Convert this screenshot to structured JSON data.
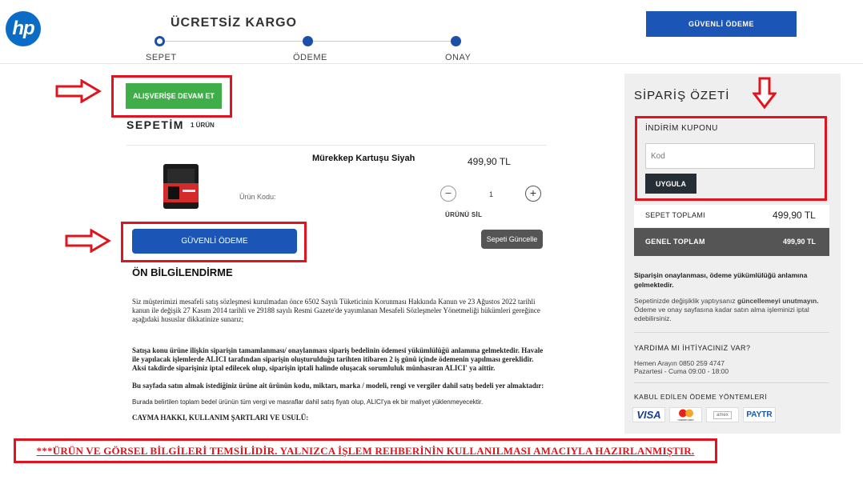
{
  "header": {
    "logo_text": "hp",
    "free_shipping": "ÜCRETSİZ KARGO",
    "steps": [
      "SEPET",
      "ÖDEME",
      "ONAY"
    ],
    "secure_button": "GÜVENLİ ÖDEME"
  },
  "cart": {
    "continue_button": "ALIŞVERİŞE DEVAM ET",
    "title": "SEPETİM",
    "count": "1 ÜRÜN",
    "item": {
      "name": "Mürekkep Kartuşu Siyah",
      "price": "499,90 TL",
      "code_label": "Ürün Kodu:",
      "quantity": "1",
      "remove": "ÜRÜNÜ SİL"
    },
    "secure_button": "GÜVENLİ ÖDEME",
    "update_button": "Sepeti Güncelle"
  },
  "info": {
    "title": "ÖN BİLGİLENDİRME",
    "p1": "Siz müşterimizi mesafeli satış sözleşmesi kurulmadan önce 6502 Sayılı Tüketicinin Korunması Hakkında Kanun ve 23 Ağustos 2022 tarihli kanun ile değişik 27 Kasım 2014 tarihli ve 29188 sayılı Resmi Gazete'de yayımlanan Mesafeli Sözleşmeler Yönetmeliği hükümleri gereğince aşağıdaki hususlar dikkatinize sunarız;",
    "p2": "Satışa konu ürüne ilişkin siparişin tamamlanması/ onaylanması sipariş bedelinin ödemesi yükümlülüğü anlamına gelmektedir. Havale ile yapılacak işlemlerde ALICI tarafından siparişin oluşturulduğu tarihten itibaren 2 iş günü içinde ödemenin yapılması gereklidir. Aksi takdirde siparişiniz iptal edilecek olup, siparişin iptali halinde oluşacak sorumluluk münhasıran ALICI' ya aittir.",
    "p3": "Bu sayfada satın almak istediğiniz ürüne ait ürünün kodu, miktarı, marka / modeli, rengi ve vergiler dahil satış bedeli yer almaktadır:",
    "p4": "Burada belirtilen toplam bedel ürünün tüm vergi ve masraflar dahil satış fiyatı olup, ALICI'ya ek bir maliyet yüklenmeyecektir.",
    "p5": "CAYMA HAKKI, KULLANIM ŞARTLARI VE USULÜ:"
  },
  "disclaimer": "***ÜRÜN VE GÖRSEL BİLGİLERİ TEMSİLİDİR. YALNIZCA İŞLEM REHBERİNİN KULLANILMASI AMACIYLA HAZIRLANMIŞTIR.",
  "summary": {
    "title": "SİPARİŞ ÖZETİ",
    "coupon_title": "İNDİRİM KUPONU",
    "coupon_placeholder": "Kod",
    "apply_button": "UYGULA",
    "subtotal_label": "SEPET TOPLAMI",
    "subtotal_value": "499,90 TL",
    "total_label": "GENEL TOPLAM",
    "total_value": "499,90 TL",
    "note1": "Siparişin onaylanması, ödeme yükümlülüğü anlamına gelmektedir.",
    "note2_a": "Sepetinizde değişiklik yaptıysanız ",
    "note2_b": "güncellemeyi unutmayın.",
    "note2_c": " Ödeme ve onay sayfasına kadar satın alma işleminizi iptal edebilirsiniz.",
    "help_title": "YARDIMA MI İHTİYACINIZ VAR?",
    "help_phone": "Hemen Arayın 0850 259 4747",
    "help_hours": "Pazartesi - Cuma 09:00 - 18:00",
    "payment_title": "KABUL EDİLEN ÖDEME YÖNTEMLERİ",
    "payments": [
      "VISA",
      "mastercard",
      "amex",
      "PAYTR"
    ]
  },
  "colors": {
    "primary_blue": "#1b55b5",
    "green": "#3fae49",
    "annotation_red": "#e0141e"
  }
}
